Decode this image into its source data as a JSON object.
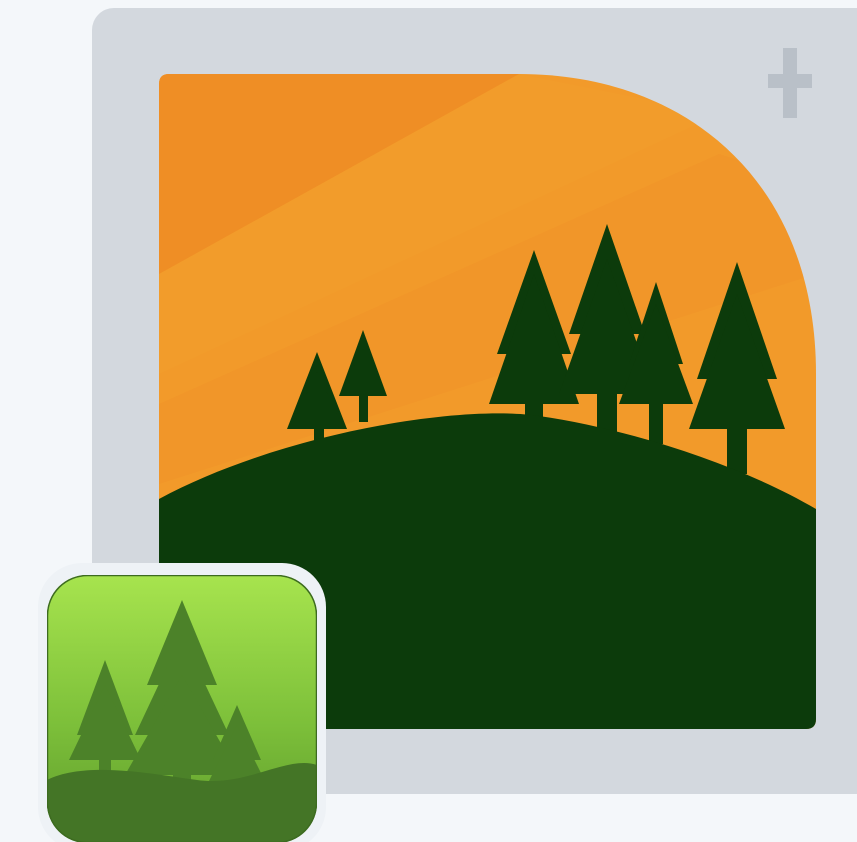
{
  "icons": {
    "add": "plus-icon",
    "landscape": "forest-hill-sunset-image",
    "app": "forest-app-icon"
  },
  "colors": {
    "page_background": "#f4f7fa",
    "frame_background": "#d3d8de",
    "plus_icon": "#b9c0c8",
    "sky_orange": "#f29a2a",
    "sky_orange_dark": "#ee8a24",
    "forest_dark_green": "#0c3b0b",
    "app_gradient_top": "#a7e44e",
    "app_gradient_bottom": "#5e9b2c",
    "app_tree_green": "#4c8229",
    "app_hill_green": "#447526"
  }
}
